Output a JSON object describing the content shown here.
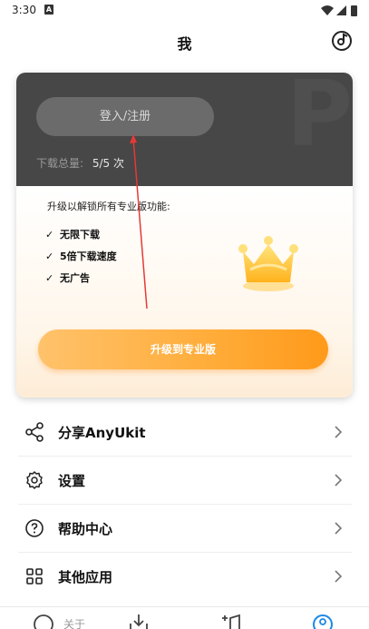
{
  "status_bar": {
    "time": "3:30",
    "notification_badge": "A",
    "icons": [
      "wifi-icon",
      "signal-icon",
      "battery-icon"
    ]
  },
  "header": {
    "title": "我",
    "action_icon": "music-disc-icon"
  },
  "card": {
    "login_button": "登入/注册",
    "download_label": "下载总量:",
    "download_value": "5/5 次",
    "upgrade_intro": "升级以解锁所有专业版功能:",
    "features": [
      "无限下载",
      "5倍下载速度",
      "无广告"
    ],
    "upgrade_button": "升级到专业版",
    "colors": {
      "dark": "#474747",
      "accent": "#ff9a1a"
    }
  },
  "menu": {
    "items": [
      {
        "label": "分享AnyUkit",
        "icon": "share-icon"
      },
      {
        "label": "设置",
        "icon": "gear-icon"
      },
      {
        "label": "帮助中心",
        "icon": "help-icon"
      },
      {
        "label": "其他应用",
        "icon": "apps-grid-icon"
      }
    ]
  },
  "bottom_nav": {
    "items": [
      {
        "icon": "home-icon",
        "label": "关于"
      },
      {
        "icon": "download-icon"
      },
      {
        "icon": "add-music-icon"
      },
      {
        "icon": "profile-icon",
        "active": true
      }
    ]
  }
}
